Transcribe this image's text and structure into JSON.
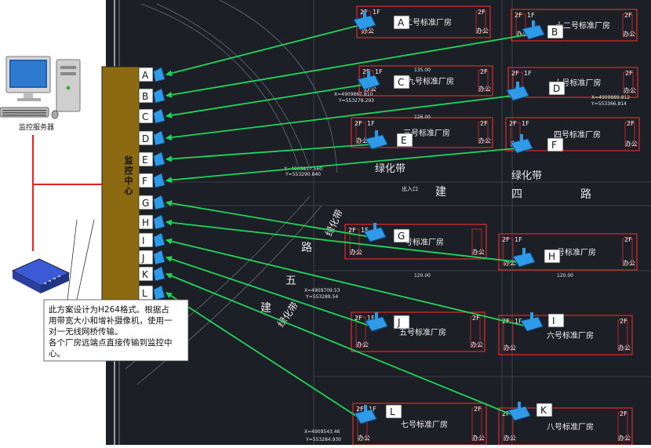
{
  "server": {
    "label": "监控服务器"
  },
  "center": {
    "label": "监控中心",
    "ports": [
      "A",
      "B",
      "C",
      "D",
      "E",
      "F",
      "G",
      "H",
      "I",
      "J",
      "K",
      "L"
    ]
  },
  "note": {
    "lines": [
      "此方案设计为H264格式。根据占",
      "用带宽大小和增补摄像机，使用一",
      "对一无线网桥传输。",
      "各个厂房远端点直接传输到监控中",
      "心。"
    ]
  },
  "buildings": [
    {
      "id": "b2",
      "name": "二号标准厂房",
      "floors": [
        "2F",
        "1F",
        "2F"
      ],
      "office": "办公"
    },
    {
      "id": "b12",
      "name": "十二号标准厂房",
      "floors": [
        "2F",
        "1F",
        "2F"
      ],
      "office": "办公"
    },
    {
      "id": "b9",
      "name": "九号标准厂房",
      "floors": [
        "2F",
        "1F",
        "2F"
      ],
      "office": "办公"
    },
    {
      "id": "b11",
      "name": "十号标准厂房",
      "floors": [
        "2F",
        "1F",
        "2F"
      ],
      "office": "办公"
    },
    {
      "id": "b3",
      "name": "三号标准厂房",
      "floors": [
        "2F",
        "1F",
        "2F"
      ],
      "office": "办公"
    },
    {
      "id": "b4",
      "name": "四号标准厂房",
      "floors": [
        "2F",
        "1F",
        "2F"
      ],
      "office": "办公"
    },
    {
      "id": "b1",
      "name": "一号标准厂房",
      "floors": [
        "2F",
        "1F"
      ],
      "office": "办公"
    },
    {
      "id": "b2b",
      "name": "二号标准厂房",
      "floors": [
        "2F",
        "1F",
        "2F"
      ],
      "office": "办公"
    },
    {
      "id": "b5",
      "name": "五号标准厂房",
      "floors": [
        "2F",
        "1F",
        "2F"
      ],
      "office": "办公"
    },
    {
      "id": "b6",
      "name": "六号标准厂房",
      "floors": [
        "2F",
        "1F",
        "2F"
      ],
      "office": "办公"
    },
    {
      "id": "b7",
      "name": "七号标准厂房",
      "floors": [
        "2F",
        "1F",
        "2F"
      ],
      "office": "办公"
    },
    {
      "id": "b8",
      "name": "八号标准厂房",
      "floors": [
        "2F",
        "1F",
        "2F"
      ],
      "office": "办公"
    }
  ],
  "map_text": {
    "green_belt": "绿化带",
    "green_belt_2": "绿化带",
    "road_a": "建",
    "road_b": "四",
    "road_c": "路",
    "road_d": "路",
    "road_e": "五",
    "road_f": "建",
    "entrance": "出入口",
    "coord1": "X=4909817.560",
    "coord2": "Y=553290.840",
    "coord3": "X=4909867.810",
    "coord4": "Y=553278.293",
    "coord5": "X=4909709.53",
    "coord6": "Y=553289.54",
    "coord7": "X=4909543.46",
    "coord8": "Y=553284.930",
    "coord9": "X=4909889.812",
    "coord10": "Y=553366.814",
    "dim1": "135.00",
    "dim2": "126.00",
    "dim3": "120.00",
    "dim4": "120.00"
  },
  "colors": {
    "link": "#1fd65a",
    "wire": "#e82020",
    "center": "#8c6a12",
    "cad_bg": "#1c1f26",
    "building": "#e02a2a"
  }
}
